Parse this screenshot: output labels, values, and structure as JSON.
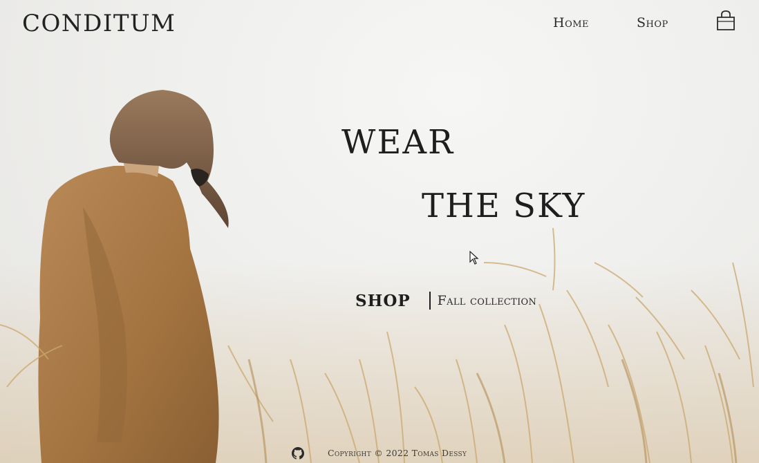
{
  "brand": {
    "logo_text": "CONDITUM"
  },
  "nav": {
    "home_label": "Home",
    "shop_label": "Shop",
    "cart_icon": "shopping-bag-icon"
  },
  "hero": {
    "line1": "WEAR",
    "line2": "THE SKY",
    "cta_label": "SHOP",
    "cta_subtitle": "Fall collection"
  },
  "footer": {
    "github_icon": "github-icon",
    "copyright": "Copyright © 2022 Tomas Dessy"
  },
  "colors": {
    "text": "#1e1e1e",
    "background": "#eeeeec",
    "sweater": "#a8794a",
    "grass": "#d6b98c"
  }
}
